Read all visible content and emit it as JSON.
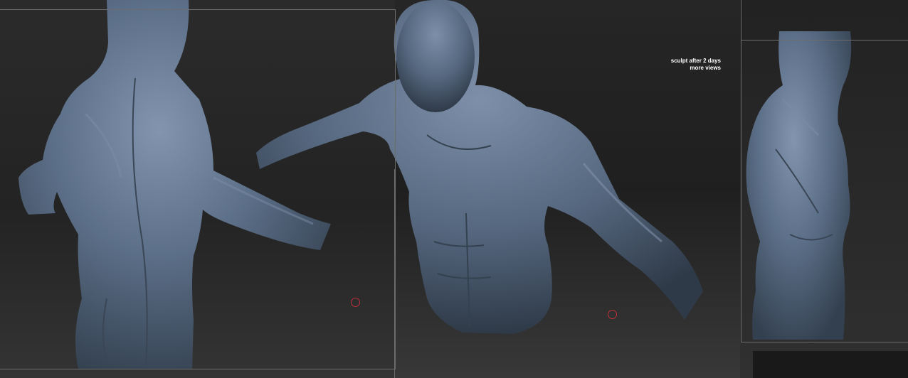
{
  "caption": {
    "line1": "sculpt after 2 days",
    "line2": "more views"
  },
  "colors": {
    "sculpt": "#5b6e87",
    "highlight": "#8395ae",
    "shadow": "#33404f",
    "marker": "#c0303b",
    "frame": "#6c6c6c"
  },
  "views": [
    "back-three-quarter-view",
    "front-view",
    "side-view"
  ]
}
